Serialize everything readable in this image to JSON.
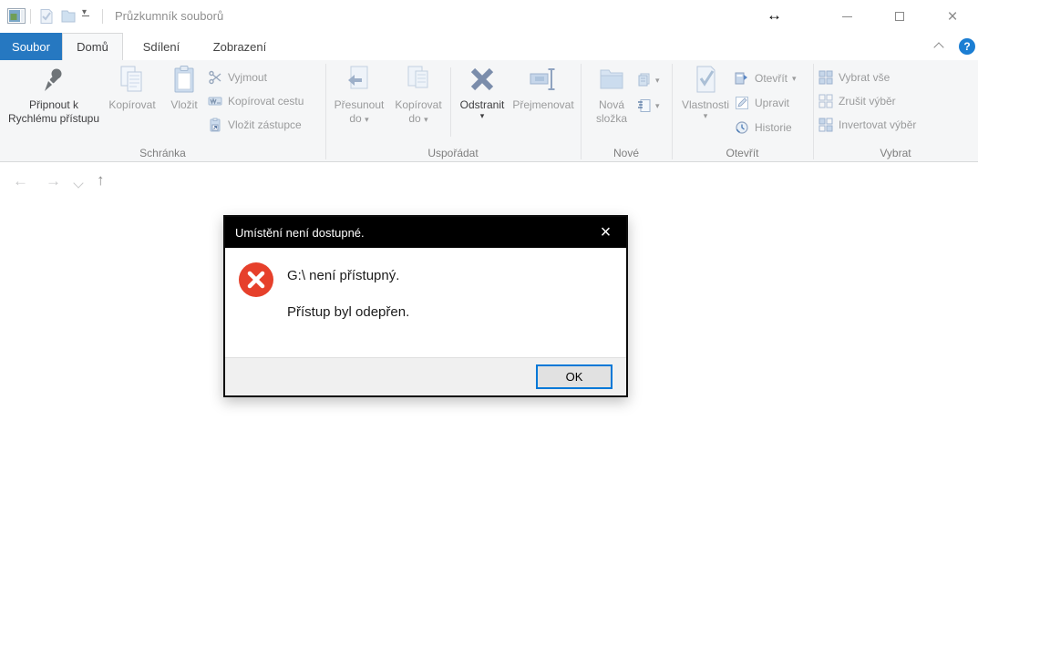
{
  "window": {
    "title": "Průzkumník souborů"
  },
  "tabs": {
    "file": "Soubor",
    "home": "Domů",
    "share": "Sdílení",
    "view": "Zobrazení"
  },
  "ribbon": {
    "clipboard": {
      "label": "Schránka",
      "pin": "Připnout k Rychlému přístupu",
      "copy": "Kopírovat",
      "paste": "Vložit",
      "cut": "Vyjmout",
      "copy_path": "Kopírovat cestu",
      "paste_shortcut": "Vložit zástupce"
    },
    "organize": {
      "label": "Uspořádat",
      "move_to": "Přesunout do",
      "copy_to": "Kopírovat do",
      "delete": "Odstranit",
      "rename": "Přejmenovat"
    },
    "new": {
      "label": "Nové",
      "new_folder": "Nová složka"
    },
    "open": {
      "label": "Otevřít",
      "properties": "Vlastnosti",
      "open": "Otevřít",
      "edit": "Upravit",
      "history": "Historie"
    },
    "select": {
      "label": "Vybrat",
      "select_all": "Vybrat vše",
      "select_none": "Zrušit výběr",
      "invert": "Invertovat výběr"
    }
  },
  "nav": {
    "address_value": "",
    "search_value": ""
  },
  "dialog": {
    "title": "Umístění není dostupné.",
    "line1": "G:\\ není přístupný.",
    "line2": "Přístup byl odepřen.",
    "ok": "OK"
  },
  "icons": {
    "back": "←",
    "forward": "→",
    "up": "↑",
    "close": "×",
    "resize_cursor": "↔",
    "caret": "▾",
    "help": "?"
  },
  "colors": {
    "accent_blue": "#2678c1",
    "help_blue": "#1b7ed3",
    "error_red": "#e6402b",
    "ok_focus_border": "#0078d7",
    "dialog_title_bg": "#000000"
  }
}
